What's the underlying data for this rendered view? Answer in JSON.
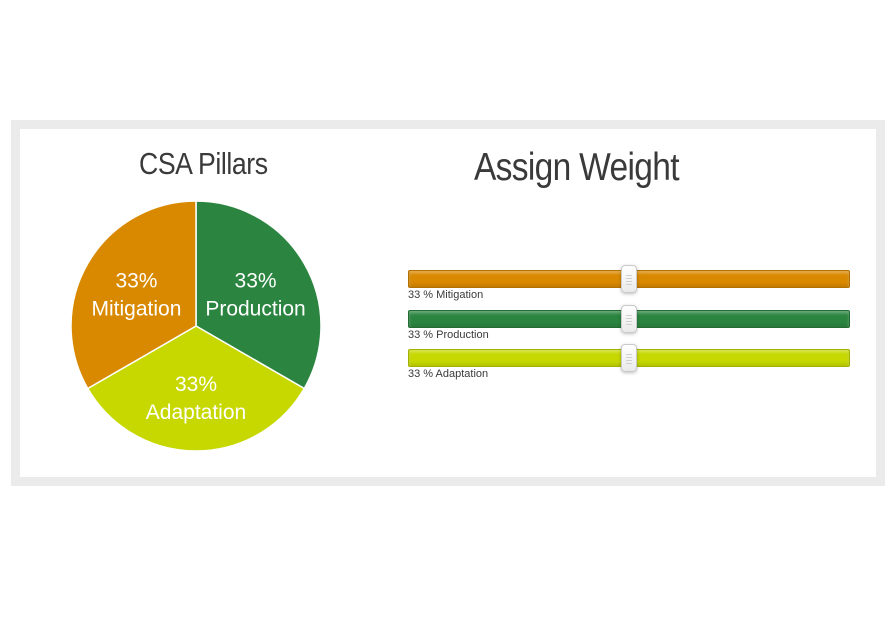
{
  "pie_panel": {
    "title": "CSA Pillars"
  },
  "weight_panel": {
    "title": "Assign Weight"
  },
  "colors": {
    "mitigation": "#d98900",
    "production": "#2b8540",
    "adaptation": "#c6d800",
    "panel_border": "#ebebeb",
    "title_text": "#3a3a3a"
  },
  "chart_data": {
    "type": "pie",
    "title": "CSA Pillars",
    "slices": [
      {
        "name": "Mitigation",
        "value": 33,
        "percent_label": "33%"
      },
      {
        "name": "Production",
        "value": 33,
        "percent_label": "33%"
      },
      {
        "name": "Adaptation",
        "value": 33,
        "percent_label": "33%"
      }
    ]
  },
  "sliders": [
    {
      "name": "Mitigation",
      "value": 33,
      "caption": "33 % Mitigation",
      "fraction": 0.5
    },
    {
      "name": "Production",
      "value": 33,
      "caption": "33 % Production",
      "fraction": 0.5
    },
    {
      "name": "Adaptation",
      "value": 33,
      "caption": "33 % Adaptation",
      "fraction": 0.5
    }
  ]
}
